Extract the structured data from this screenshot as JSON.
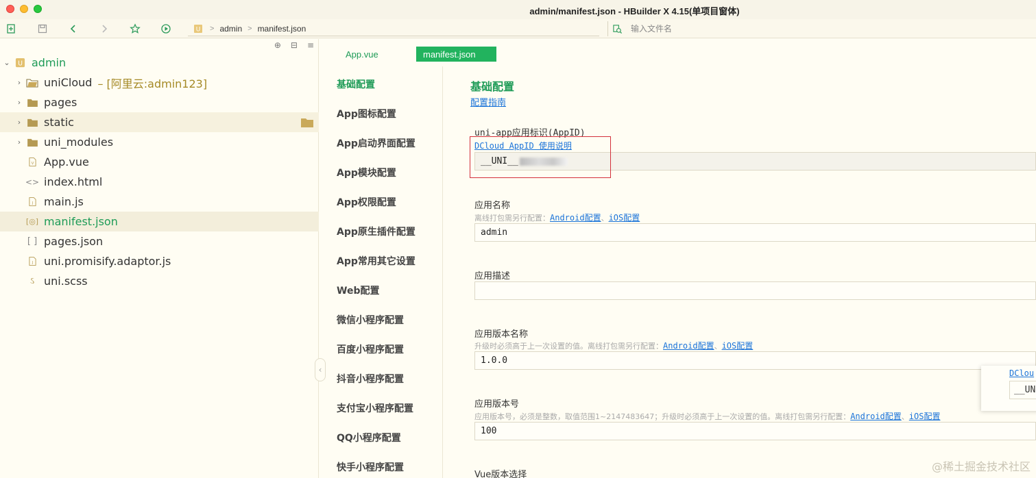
{
  "window": {
    "title": "admin/manifest.json - HBuilder X 4.15(单项目窗体)"
  },
  "toolbar": {
    "breadcrumb": [
      "admin",
      "manifest.json"
    ],
    "search_placeholder": "输入文件名"
  },
  "sidebar": {
    "root": "admin",
    "items": [
      {
        "label": "uniCloud",
        "sub": "– [阿里云:admin123]",
        "kind": "cloud-folder"
      },
      {
        "label": "pages",
        "kind": "folder"
      },
      {
        "label": "static",
        "kind": "folder"
      },
      {
        "label": "uni_modules",
        "kind": "folder"
      },
      {
        "label": "App.vue",
        "kind": "vue-file"
      },
      {
        "label": "index.html",
        "kind": "html-file"
      },
      {
        "label": "main.js",
        "kind": "js-file"
      },
      {
        "label": "manifest.json",
        "kind": "manifest-file"
      },
      {
        "label": "pages.json",
        "kind": "json-file"
      },
      {
        "label": "uni.promisify.adaptor.js",
        "kind": "js-file"
      },
      {
        "label": "uni.scss",
        "kind": "scss-file"
      }
    ]
  },
  "tabs": [
    {
      "label": "App.vue",
      "active": false
    },
    {
      "label": "manifest.json",
      "active": true
    }
  ],
  "config_nav": [
    "基础配置",
    "App图标配置",
    "App启动界面配置",
    "App模块配置",
    "App权限配置",
    "App原生插件配置",
    "App常用其它设置",
    "Web配置",
    "微信小程序配置",
    "百度小程序配置",
    "抖音小程序配置",
    "支付宝小程序配置",
    "QQ小程序配置",
    "快手小程序配置"
  ],
  "content": {
    "title": "基础配置",
    "guide_link": "配置指南",
    "appid": {
      "label": "uni-app应用标识(AppID)",
      "help_link": "DCloud AppID 使用说明",
      "value_prefix": "__UNI__"
    },
    "app_name": {
      "label": "应用名称",
      "hint": "离线打包需另行配置：",
      "link_android": "Android配置",
      "sep": "、",
      "link_ios": "iOS配置",
      "value": "admin"
    },
    "app_desc": {
      "label": "应用描述",
      "value": ""
    },
    "version_name": {
      "label": "应用版本名称",
      "hint": "升级时必须高于上一次设置的值。离线打包需另行配置：",
      "link_android": "Android配置",
      "sep": "、",
      "link_ios": "iOS配置",
      "value": "1.0.0"
    },
    "version_code": {
      "label": "应用版本号",
      "hint": "应用版本号，必须是整数，取值范围1~2147483647；升级时必须高于上一次设置的值。离线打包需另行配置：",
      "link_android": "Android配置",
      "sep": "、",
      "link_ios": "iOS配置",
      "value": "100"
    },
    "vue_version_label": "Vue版本选择"
  },
  "popover": {
    "link": "DClou",
    "value": "__UN"
  },
  "watermark": "@稀土掘金技术社区",
  "colors": {
    "accent": "#1e9b57",
    "active_tab": "#22b35e",
    "link": "#1a73d9",
    "highlight": "#d32f3a"
  }
}
